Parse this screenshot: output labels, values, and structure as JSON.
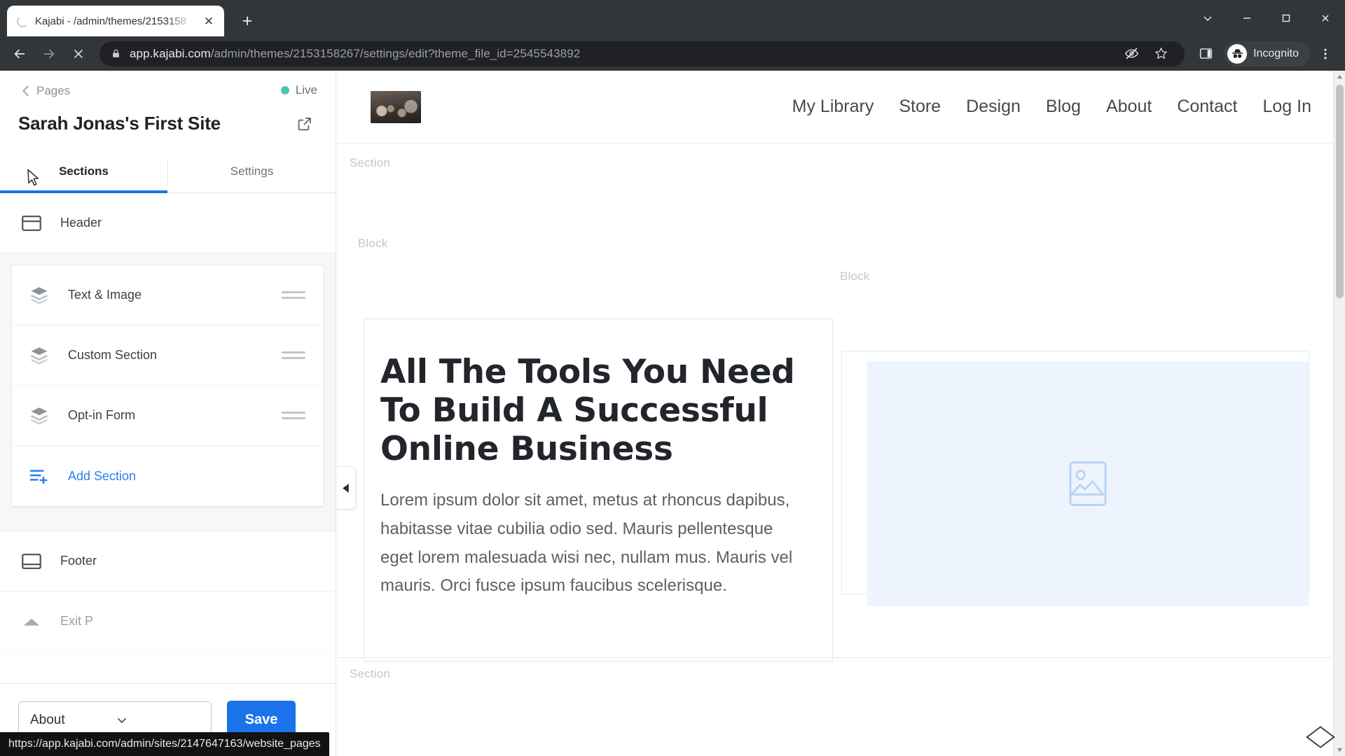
{
  "browser": {
    "tab": {
      "title": "Kajabi - /admin/themes/2153158",
      "close_label": "✕",
      "new_tab_label": "+"
    },
    "omnibox": {
      "url_domain": "app.kajabi.com",
      "url_path": "/admin/themes/2153158267/settings/edit?theme_file_id=2545543892"
    },
    "profile_label": "Incognito",
    "status_url": "https://app.kajabi.com/admin/sites/2147647163/website_pages"
  },
  "editor": {
    "back_label": "Pages",
    "status_label": "Live",
    "status_color": "#49c5b1",
    "site_title": "Sarah Jonas's First Site",
    "tabs": [
      {
        "label": "Sections",
        "active": true
      },
      {
        "label": "Settings",
        "active": false
      }
    ],
    "top_items": [
      {
        "label": "Header",
        "icon": "header-layout-icon"
      }
    ],
    "group_items": [
      {
        "label": "Text & Image",
        "icon": "layers-icon"
      },
      {
        "label": "Custom Section",
        "icon": "layers-icon"
      },
      {
        "label": "Opt-in Form",
        "icon": "layers-icon"
      }
    ],
    "add_section_label": "Add Section",
    "bottom_items": [
      {
        "label": "Footer",
        "icon": "footer-layout-icon"
      },
      {
        "label": "Exit P",
        "icon": "chevron-up-icon"
      }
    ],
    "footer": {
      "page_select_value": "About",
      "save_label": "Save"
    }
  },
  "preview": {
    "nav_links": [
      "My Library",
      "Store",
      "Design",
      "Blog",
      "About",
      "Contact",
      "Log In"
    ],
    "zone_labels": {
      "section_top": "Section",
      "block_left": "Block",
      "block_right": "Block",
      "section_bottom": "Section"
    },
    "headline": "All The Tools You Need To Build A Successful Online Business",
    "paragraph": "Lorem ipsum dolor sit amet, metus at rhoncus dapibus, habitasse vitae cubilia odio sed. Mauris pellentesque eget lorem malesuada wisi nec, nullam mus. Mauris vel mauris. Orci fusce ipsum faucibus scelerisque.",
    "image_placeholder_bg": "#eef4fd",
    "image_placeholder_stroke": "#b9d5f2"
  },
  "colors": {
    "accent_blue": "#1a73e8",
    "link_blue": "#2d7ff0",
    "chrome_dark": "#323639",
    "omnibox_dark": "#202124"
  }
}
